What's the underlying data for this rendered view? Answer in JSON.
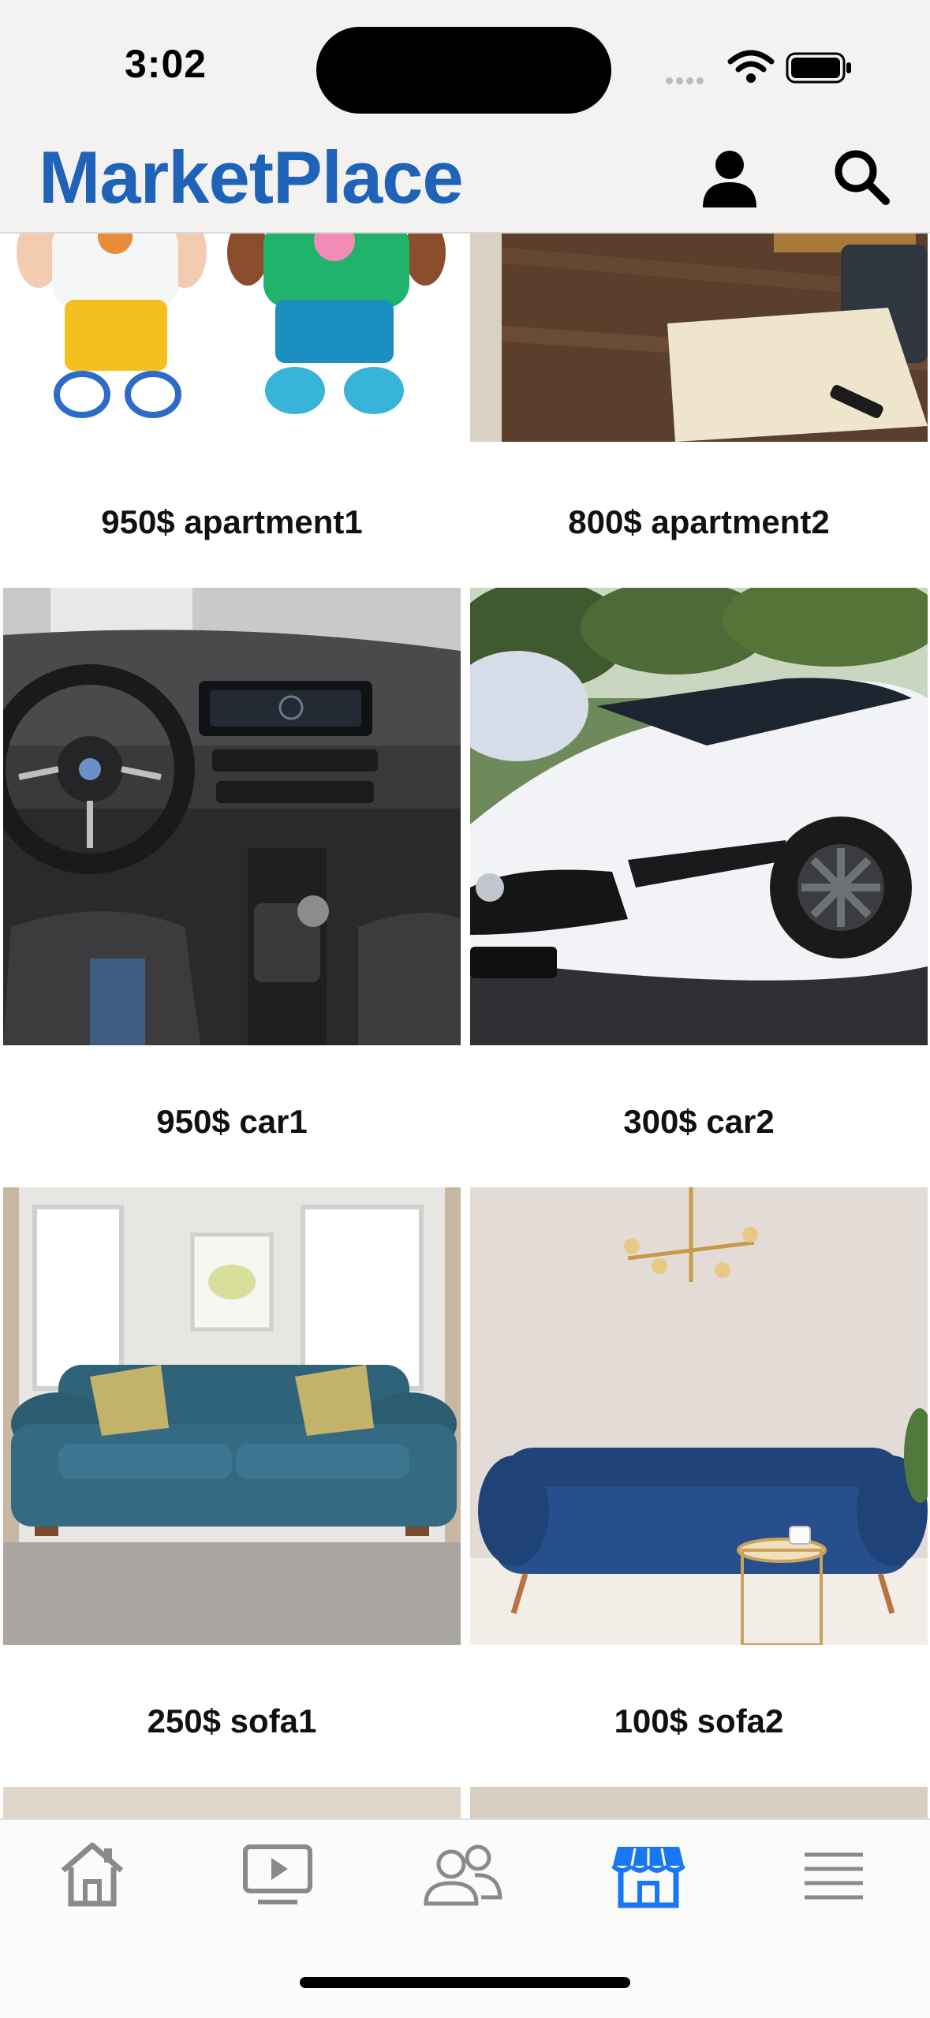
{
  "status_bar": {
    "time": "3:02"
  },
  "header": {
    "title": "MarketPlace"
  },
  "listings": [
    {
      "price": "950$",
      "name": "apartment1",
      "label": "950$ apartment1"
    },
    {
      "price": "800$",
      "name": "apartment2",
      "label": "800$ apartment2"
    },
    {
      "price": "950$",
      "name": "car1",
      "label": "950$ car1"
    },
    {
      "price": "300$",
      "name": "car2",
      "label": "300$ car2"
    },
    {
      "price": "250$",
      "name": "sofa1",
      "label": "250$ sofa1"
    },
    {
      "price": "100$",
      "name": "sofa2",
      "label": "100$ sofa2"
    }
  ],
  "tabbar": {
    "active": "marketplace",
    "items": [
      "home",
      "video",
      "friends",
      "marketplace",
      "menu"
    ]
  },
  "colors": {
    "brand": "#1f63b8",
    "active_tab": "#1877f2",
    "inactive_tab": "#8a8a8a"
  }
}
